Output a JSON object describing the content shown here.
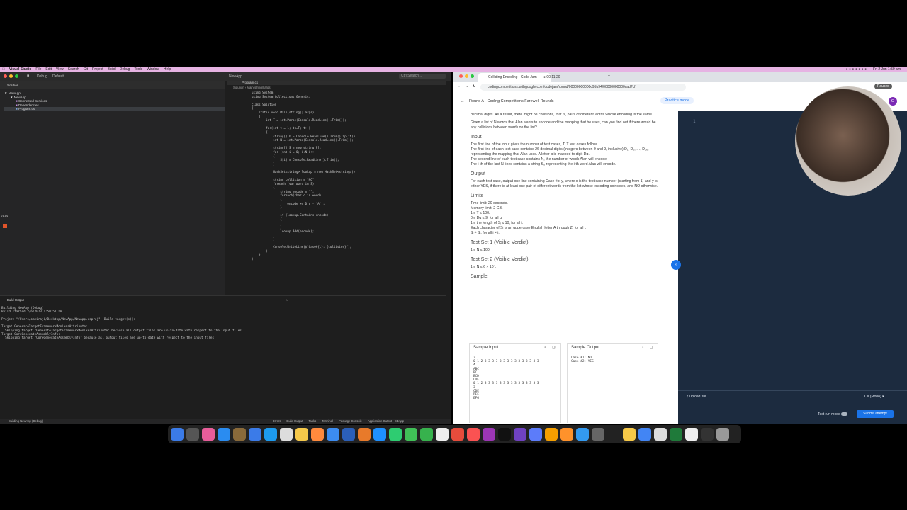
{
  "menubar": {
    "app": "Visual Studio",
    "items": [
      "File",
      "Edit",
      "View",
      "Search",
      "Git",
      "Project",
      "Build",
      "Debug",
      "Tools",
      "Window",
      "Help"
    ],
    "clock": "Fri 2 Jun 1:50 am"
  },
  "vs": {
    "window_title": "NewApp",
    "config": "Debug",
    "target": "Default",
    "search_placeholder": "Ctrl Search...",
    "solution_header": "Solution",
    "tree": [
      "NewApp",
      "NewApp",
      "Connected Services",
      "Dependencies",
      "Program.cs"
    ],
    "tab": "Program.cs",
    "breadcrumb": [
      "Solution",
      "Main(string[] args)"
    ],
    "code": [
      "using System;",
      "using System.Collections.Generic;",
      "",
      "class Solution",
      "{",
      "    static void Main(string[] args)",
      "    {",
      "        int T = int.Parse(Console.ReadLine().Trim());",
      "",
      "        for(int t = 1; t<=T; t++)",
      "        {",
      "            string[] D = Console.ReadLine().Trim().Split();",
      "            int N = int.Parse(Console.ReadLine().Trim());",
      "",
      "            string[] S = new string[N];",
      "            for (int i = 0; i<N;i++)",
      "            {",
      "                S[i] = Console.ReadLine().Trim();",
      "            }",
      "",
      "            HashSet<string> lookup = new HashSet<string>();",
      "",
      "            string collision = \"NO\";",
      "            foreach (var word in S)",
      "            {",
      "                string encode = \"\";",
      "                foreach(char c in word)",
      "                {",
      "                    encode += D[c - 'A'];",
      "                }",
      "",
      "                if (lookup.Contains(encode))",
      "                {",
      "",
      "                }",
      "                lookup.Add(encode);",
      "",
      "            }",
      "",
      "            Console.WriteLine($\"Case#{t}: {collision}\");",
      "        }",
      "    }",
      "}"
    ],
    "build_title": "Build Output",
    "build_lines": [
      "Building NewApp (Debug)",
      "Build started 2/6/2023 1:50:51 am.",
      "",
      "Project \"/Users/omeiraji/Desktop/NewApp/NewApp.csproj\" (Build target(s)):",
      "",
      "Target GenerateTargetFrameworkMonikerAttribute:",
      "  Skipping target \"GenerateTargetFrameworkMonikerAttribute\" because all output files are up-to-date with respect to the input files.",
      "Target CoreGenerateAssemblyInfo:",
      "  Skipping target \"CoreGenerateAssemblyInfo\" because all output files are up-to-date with respect to the input files."
    ],
    "status": "Building NewApp (Debug)",
    "bottom_tabs": [
      "Errors",
      "Build Output",
      "Tasks",
      "Terminal",
      "Package Console",
      "Application Output - CEApp"
    ],
    "side_time": "13:13"
  },
  "chrome": {
    "tab1": "Colliding Encoding - Code Jam",
    "tab2": "00:11:20",
    "url": "codingcompetitions.withgoogle.com/codejam/round/00000000000c95b94/00000000000cad7cf",
    "round_title": "Round A - Coding Competitions Farewell Rounds",
    "practice": "Practice mode",
    "avatar": "O",
    "paused": "Paused"
  },
  "problem": {
    "intro": "decimal digits. As a result, there might be collisions, that is, pairs of different words whose encoding is the same.",
    "question": "Given a list of N words that Alan wants to encode and the mapping that he uses, can you find out if there would be any collisions between words on the list?",
    "input_h": "Input",
    "input_text": [
      "The first line of the input gives the number of test cases, T. T test cases follow.",
      "The first line of each test case contains 26 decimal digits (integers between 0 and 9, inclusive) D₁, D₂, …, D₂₆, representing the mapping that Alan uses. A letter α is mapped to digit Dα.",
      "The second line of each test case contains N, the number of words Alan will encode.",
      "The i-th of the last N lines contains a string Sᵢ, representing the i-th word Alan will encode."
    ],
    "output_h": "Output",
    "output_text": "For each test case, output one line containing Case #x: y, where x is the test case number (starting from 1) and y is either YES, if there is at least one pair of different words from the list whose encoding coincides, and NO otherwise.",
    "limits_h": "Limits",
    "limits": [
      "Time limit: 20 seconds.",
      "Memory limit: 2 GB.",
      "1 ≤ T ≤ 100.",
      "0 ≤ Dα ≤ 9, for all α.",
      "1 ≤ the length of Sᵢ ≤ 10, for all i.",
      "Each character of Sᵢ is an uppercase English letter A through Z, for all i.",
      "Sᵢ ≠ Sⱼ, for all i ≠ j."
    ],
    "ts1_h": "Test Set 1 (Visible Verdict)",
    "ts1": "1 ≤ N ≤ 100.",
    "ts2_h": "Test Set 2 (Visible Verdict)",
    "ts2": "1 ≤ N ≤ 6 × 10⁴.",
    "sample_h": "Sample",
    "sample_input_h": "Sample Input",
    "sample_output_h": "Sample Output",
    "sample_input": [
      "2",
      "0 1 2 3 3 3 3 3 3 3 3 3 3 3 3 3 3 3",
      "4",
      "ABC",
      "BC",
      "BCD",
      "CDE",
      "0 1 2 3 3 3 3 3 3 3 3 3 3 3 3 3 3 3",
      "3",
      "CDE",
      "DEF",
      "EFG"
    ],
    "sample_output": [
      "Case #1: NO",
      "Case #2: YES"
    ]
  },
  "editor_pane": {
    "line_no": "1",
    "upload": "Upload file",
    "lang": "C# (Mono)",
    "test_run": "Test run mode",
    "submit": "Submit attempt"
  }
}
